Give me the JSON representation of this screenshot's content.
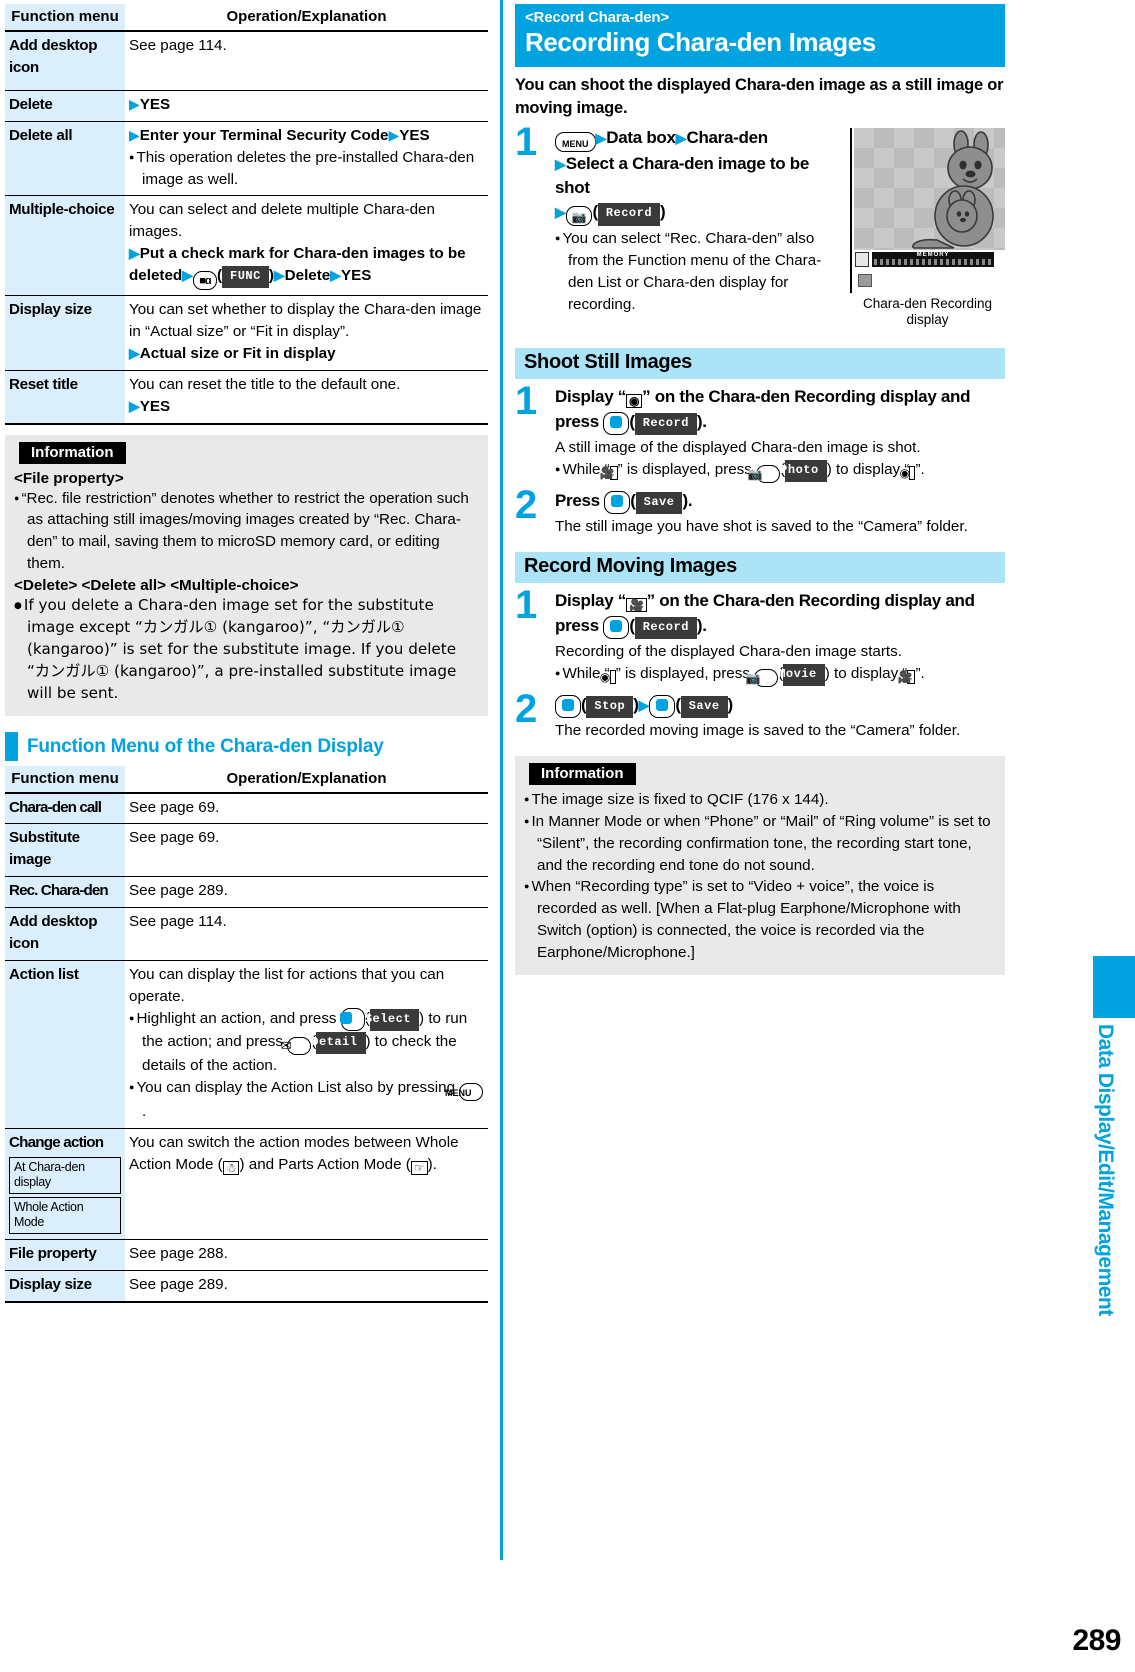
{
  "page": {
    "number": "289",
    "side_tab": "Data Display/Edit/Management"
  },
  "left": {
    "table1": {
      "headers": [
        "Function menu",
        "Operation/Explanation"
      ],
      "rows": [
        {
          "key": "Add desktop icon",
          "lines": [
            {
              "t": "See page 114."
            }
          ]
        },
        {
          "key": "Delete",
          "lines": [
            {
              "t": "YES",
              "tri": true,
              "bold": true
            }
          ]
        },
        {
          "key": "Delete all",
          "lines": [
            {
              "t": "Enter your Terminal Security Code",
              "tri": true,
              "bold": true,
              "tri2": "YES"
            },
            {
              "t": "This operation deletes the pre-installed Chara-den image as well.",
              "bullet": true
            }
          ]
        },
        {
          "key": "Multiple-choice",
          "lines": [
            {
              "t": "You can select and delete multiple Chara-den images."
            },
            {
              "t": "Put a check mark for Chara-den images to be deleted",
              "tri": true,
              "bold": true,
              "keys": "FUNC-then-delete-yes"
            }
          ]
        },
        {
          "key": "Display size",
          "lines": [
            {
              "t": "You can set whether to display the Chara-den image in “Actual size” or “Fit in display”."
            },
            {
              "t": "Actual size or Fit in display",
              "tri": true,
              "bold": true
            }
          ]
        },
        {
          "key": "Reset title",
          "lines": [
            {
              "t": "You can reset the title to the default one."
            },
            {
              "t": "YES",
              "tri": true,
              "bold": true
            }
          ]
        }
      ]
    },
    "info1": {
      "tag": "Information",
      "blocks": [
        {
          "sub": "<File property>",
          "items": [
            "“Rec. file restriction” denotes whether to restrict the operation such as attaching still images/moving images created by “Rec. Chara-den” to mail, saving them to microSD memory card, or editing them."
          ]
        },
        {
          "sub": "<Delete> <Delete all> <Multiple-choice>",
          "items": [
            "If you delete a Chara-den image set for the substitute image except “カンガル① (kangaroo)”, “カンガル① (kangaroo)” is set for the substitute image. If you delete “カンガル① (kangaroo)”, a pre-installed substitute image will be sent."
          ]
        }
      ]
    },
    "section2_title": "Function Menu of the Chara-den Display",
    "table2": {
      "headers": [
        "Function menu",
        "Operation/Explanation"
      ],
      "rows": [
        {
          "key": "Chara-den call",
          "lines": [
            {
              "t": "See page 69."
            }
          ]
        },
        {
          "key": "Substitute image",
          "lines": [
            {
              "t": "See page 69."
            }
          ]
        },
        {
          "key": "Rec. Chara-den",
          "lines": [
            {
              "t": "See page 289."
            }
          ]
        },
        {
          "key": "Add desktop icon",
          "lines": [
            {
              "t": "See page 114."
            }
          ]
        },
        {
          "key": "Action list",
          "lines": [
            {
              "t": "You can display the list for actions that you can operate."
            },
            {
              "t": "Highlight an action, and press",
              "bullet": true,
              "keys": "select-detail"
            },
            {
              "t": "You can display the Action List also by pressing",
              "bullet": true,
              "keys": "menu"
            }
          ]
        },
        {
          "key": "Change action",
          "badges": [
            "At Chara-den display",
            "Whole Action Mode"
          ],
          "lines": [
            {
              "t": "You can switch the action modes between Whole Action Mode (  ) and Parts Action Mode (  ).",
              "keys": "actionmodes"
            }
          ]
        },
        {
          "key": "File property",
          "lines": [
            {
              "t": "See page 288."
            }
          ]
        },
        {
          "key": "Display size",
          "lines": [
            {
              "t": "See page 289."
            }
          ]
        }
      ]
    }
  },
  "right": {
    "topic_small": "<Record Chara-den>",
    "topic_big": "Recording Chara-den Images",
    "lead": "You can shoot the displayed Chara-den image as a still image or moving image.",
    "step1": {
      "num": "1",
      "line1_a": "Data box",
      "line1_b": "Chara-den",
      "line2": "Select a Chara-den image to be shot",
      "line3_softkey": "Record",
      "note": "You can select “Rec. Chara-den” also from the Function menu of the Chara-den List or Chara-den display for recording."
    },
    "figure_caption": "Chara-den Recording display",
    "figure_memory_label": "MEMORY",
    "still": {
      "heading": "Shoot Still Images",
      "step1_num": "1",
      "step1_title_a": "Display “",
      "step1_title_b": "” on the Chara-den Recording display and press",
      "step1_softkey": "Record",
      "step1_desc": "A still image of the displayed Chara-den image is shot.",
      "step1_note_a": "While “",
      "step1_note_b": "” is displayed, press",
      "step1_note_softkey": "Photo",
      "step1_note_c": ") to display",
      "step2_num": "2",
      "step2_title": "Press",
      "step2_softkey": "Save",
      "step2_desc": "The still image you have shot is saved to the “Camera” folder."
    },
    "moving": {
      "heading": "Record Moving Images",
      "step1_num": "1",
      "step1_title_a": "Display “",
      "step1_title_b": "” on the Chara-den Recording display and press",
      "step1_softkey": "Record",
      "step1_desc": "Recording of the displayed Chara-den image starts.",
      "step1_note_a": "While “",
      "step1_note_b": "” is displayed, press",
      "step1_note_softkey": "Movie",
      "step1_note_c": ") to display",
      "step2_num": "2",
      "step2_softkey_a": "Stop",
      "step2_softkey_b": "Save",
      "step2_desc": "The recorded moving image is saved to the “Camera” folder."
    },
    "info": {
      "tag": "Information",
      "items": [
        "The image size is fixed to QCIF (176 x 144).",
        "In Manner Mode or when “Phone” or “Mail” of “Ring volume” is set to “Silent”, the recording confirmation tone, the recording start tone, and the recording end tone do not sound.",
        "When “Recording type” is set to “Video + voice”, the voice is recorded as well. [When a Flat-plug Earphone/Microphone with Switch (option) is connected, the voice is recorded via the Earphone/Microphone.]"
      ]
    }
  },
  "labels": {
    "softkey_func": "FUNC",
    "softkey_select": "Select",
    "softkey_detail": "Detail",
    "key_menu": "MENU",
    "delete": "Delete",
    "yes": "YES",
    "press_to_run": "to run the action; and press",
    "check_details": "check the details of the action.",
    "change_action_a": "You can switch the action modes between Whole",
    "change_action_b": "Action Mode (",
    "change_action_c": ") and Parts Action Mode (",
    "change_action_d": ")."
  },
  "colors": {
    "accent": "#00a2e0",
    "key_cell": "#daeefb",
    "subhead": "#ace4f7",
    "info_bg": "#e9e9e9"
  }
}
